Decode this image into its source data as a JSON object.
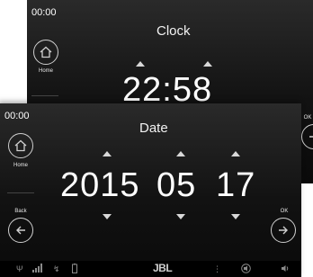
{
  "clock_screen": {
    "status_time": "00:00",
    "title": "Clock",
    "home_label": "Home",
    "time_value": "22:58",
    "ok_label": "OK"
  },
  "date_screen": {
    "status_time": "00:00",
    "title": "Date",
    "home_label": "Home",
    "back_label": "Back",
    "ok_label": "OK",
    "year": "2015",
    "month": "05",
    "day": "17"
  },
  "bottom_bar": {
    "brand": "JBL",
    "icons": [
      "signal-icon",
      "bars-icon",
      "bluetooth-icon",
      "battery-icon",
      "mic-icon",
      "mute-icon",
      "volume-icon"
    ]
  },
  "colors": {
    "background": "#121212",
    "text": "#ffffff",
    "accent": "#d8d8d8"
  }
}
